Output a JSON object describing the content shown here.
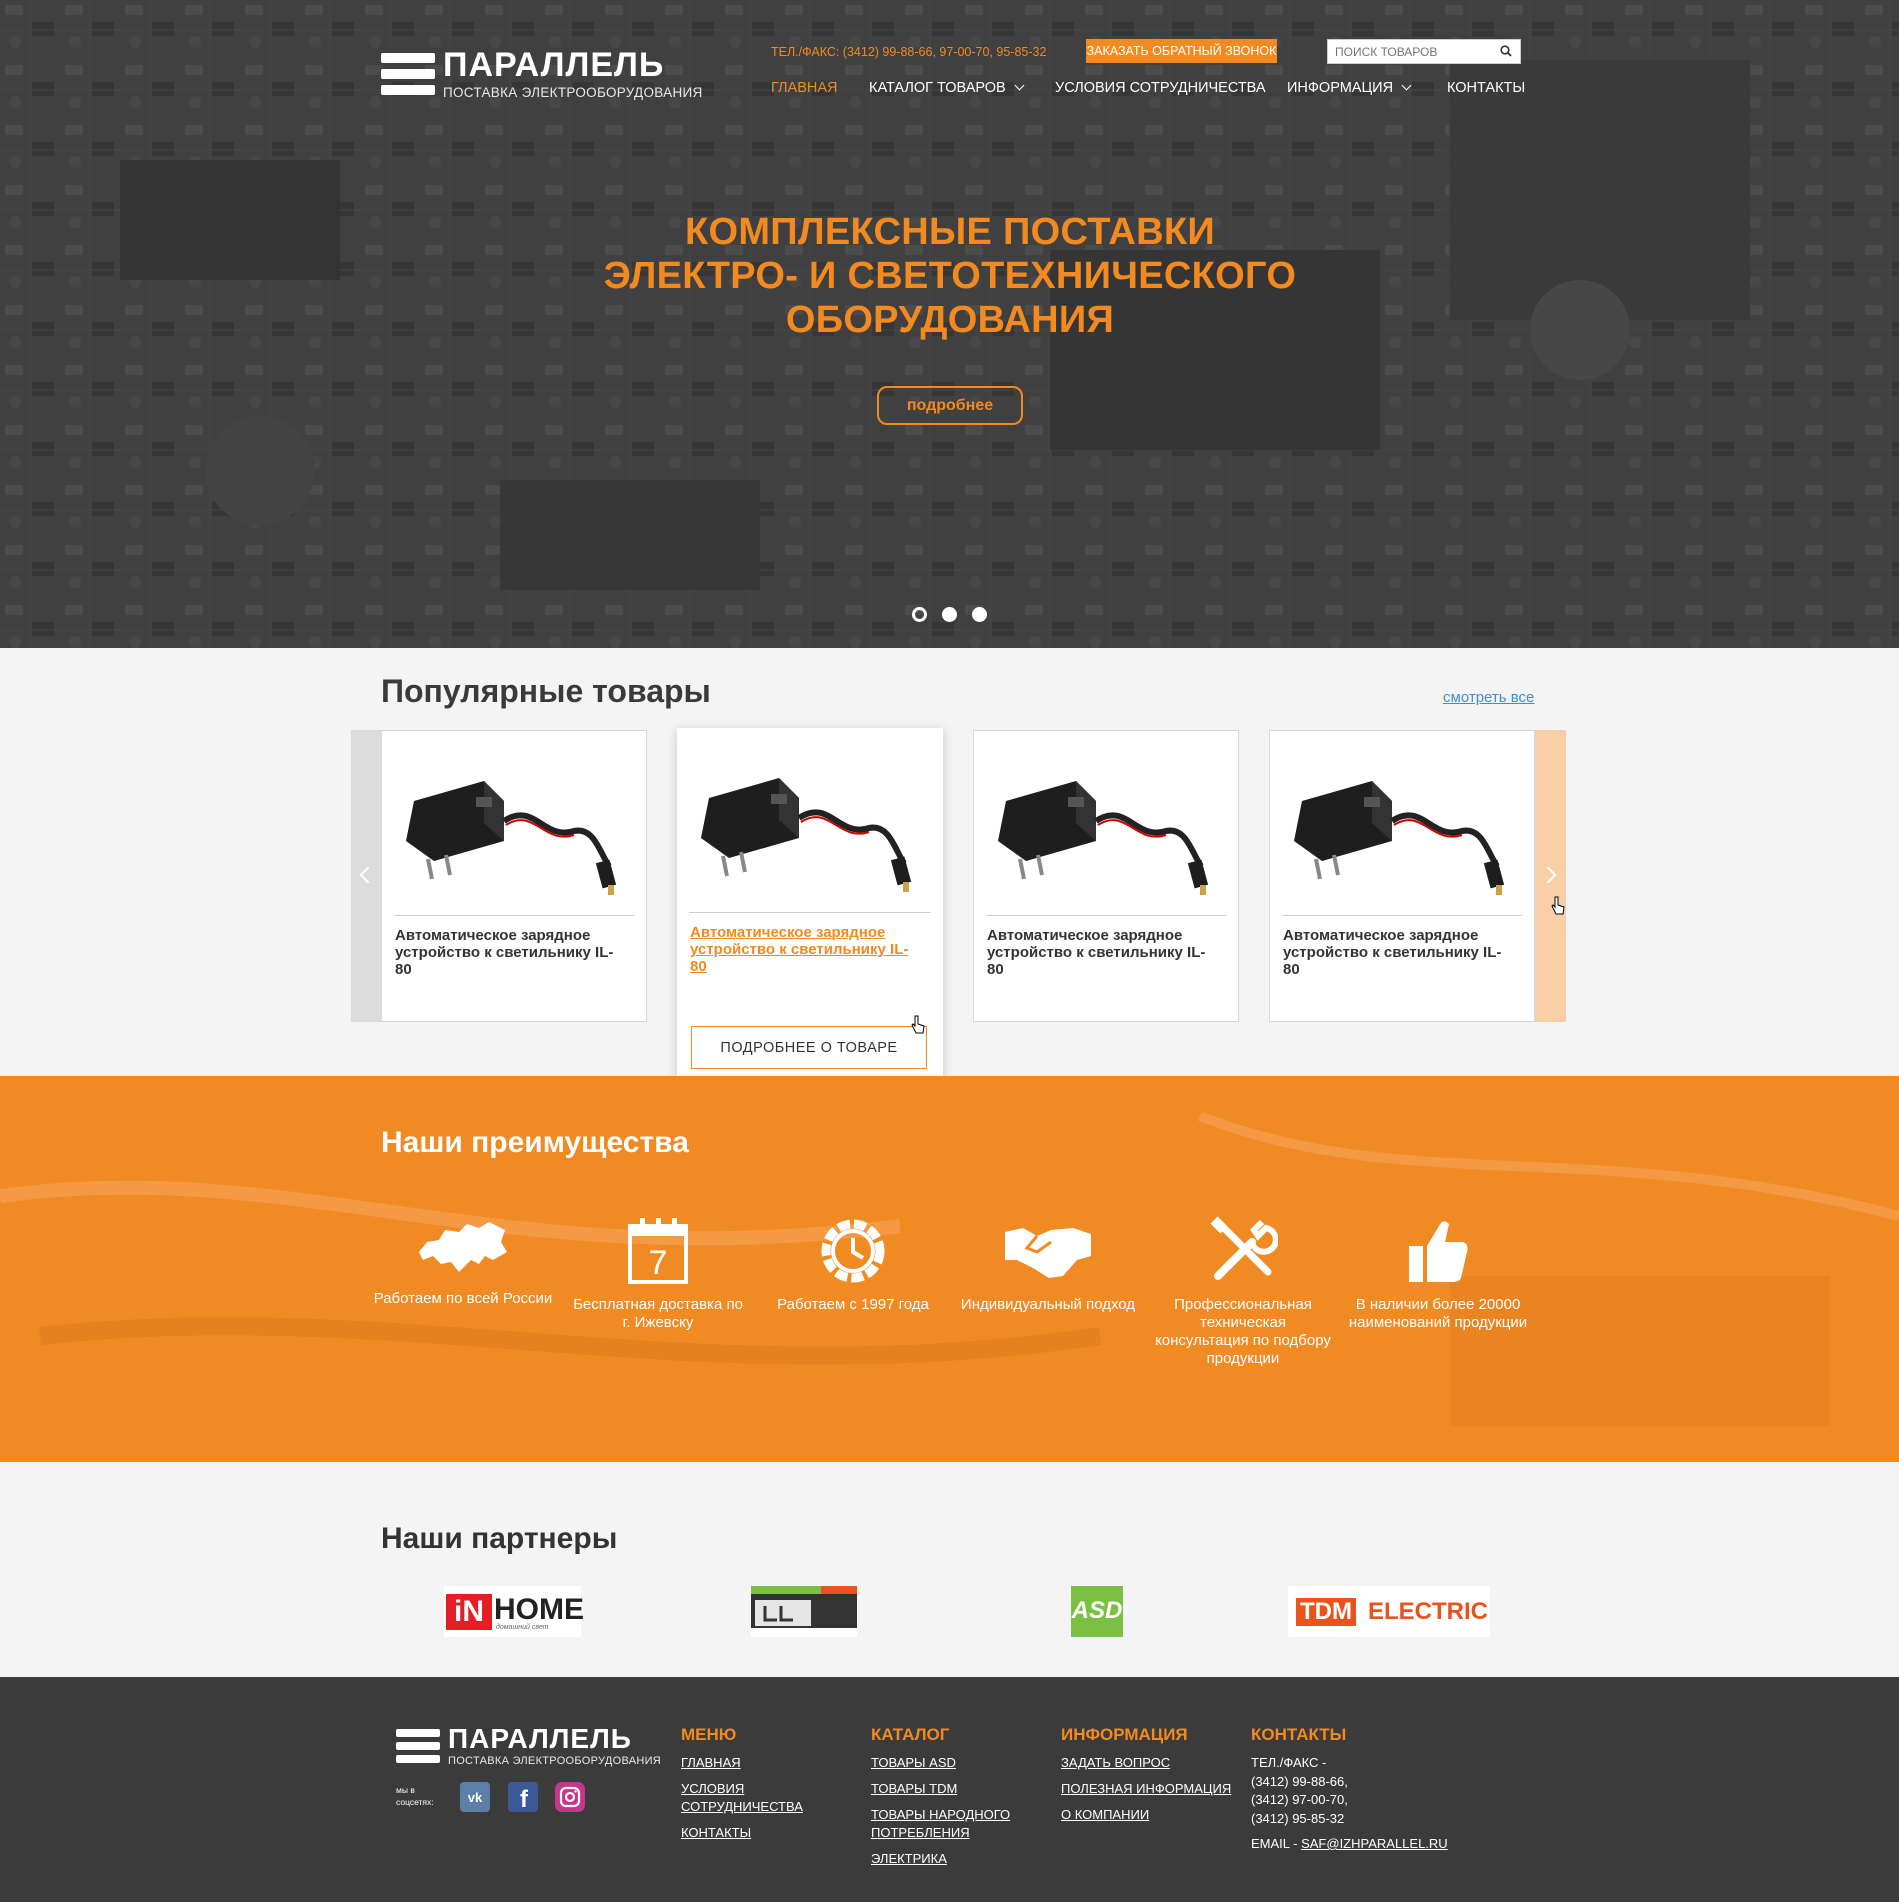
{
  "header": {
    "logo_title": "ПАРАЛЛЕЛЬ",
    "logo_subtitle": "ПОСТАВКА ЭЛЕКТРООБОРУДОВАНИЯ",
    "phone": "ТЕЛ./ФАКС: (3412) 99-88-66, 97-00-70, 95-85-32",
    "callback_button": "ЗАКАЗАТЬ ОБРАТНЫЙ ЗВОНОК",
    "search_placeholder": "ПОИСК ТОВАРОВ",
    "search_icon": "search-icon",
    "nav": [
      {
        "label": "ГЛАВНАЯ",
        "active": true
      },
      {
        "label": "КАТАЛОГ ТОВАРОВ",
        "dropdown": true
      },
      {
        "label": "УСЛОВИЯ СОТРУДНИЧЕСТВА"
      },
      {
        "label": "ИНФОРМАЦИЯ",
        "dropdown": true
      },
      {
        "label": "КОНТАКТЫ"
      }
    ]
  },
  "hero": {
    "title_line1": "КОМПЛЕКСНЫЕ ПОСТАВКИ",
    "title_line2": "ЭЛЕКТРО- И СВЕТОТЕХНИЧЕСКОГО",
    "title_line3": "ОБОРУДОВАНИЯ",
    "button": "подробнее",
    "slides_count": 3,
    "active_slide": 1
  },
  "popular": {
    "title": "Популярные товары",
    "see_all": "смотреть все",
    "products": [
      {
        "name": "Автоматическое зарядное устройство к светильнику IL-80",
        "hovered": false
      },
      {
        "name": "Автоматическое зарядное устройство к светильнику IL-80",
        "hovered": true,
        "button": "ПОДРОБНЕЕ О ТОВАРЕ"
      },
      {
        "name": "Автоматическое зарядное устройство к светильнику IL-80",
        "hovered": false
      },
      {
        "name": "Автоматическое зарядное устройство к светильнику IL-80",
        "hovered": false
      }
    ]
  },
  "advantages": {
    "title": "Наши преимущества",
    "items": [
      {
        "icon": "russia-map-icon",
        "label": "Работаем по всей России"
      },
      {
        "icon": "calendar-icon",
        "label": "Бесплатная доставка по г. Ижевску",
        "calendar_day": "7"
      },
      {
        "icon": "clock-gear-icon",
        "label": "Работаем с 1997 года"
      },
      {
        "icon": "handshake-icon",
        "label": "Индивидуальный подход"
      },
      {
        "icon": "tools-icon",
        "label": "Профессиональная техническая консультация по подбору продукции"
      },
      {
        "icon": "thumbs-up-icon",
        "label": "В наличии более 20000 наименований продукции"
      }
    ]
  },
  "partners": {
    "title": "Наши партнеры",
    "logos": [
      {
        "name": "iN HOME",
        "text_a": "iN",
        "text_b": "HOME",
        "sub": "домашний свет"
      },
      {
        "name": "partner-2-logo"
      },
      {
        "name": "ASD",
        "text": "ASD"
      },
      {
        "name": "TDM ELECTRIC",
        "text_a": "TDM",
        "text_b": "ELECTRIC"
      }
    ]
  },
  "footer": {
    "logo_title": "ПАРАЛЛЕЛЬ",
    "logo_subtitle": "ПОСТАВКА ЭЛЕКТРООБОРУДОВАНИЯ",
    "social_label_1": "мы в",
    "social_label_2": "соцсетях:",
    "social": [
      "vk-icon",
      "facebook-icon",
      "instagram-icon"
    ],
    "menu": {
      "title": "МЕНЮ",
      "links": [
        "ГЛАВНАЯ",
        "УСЛОВИЯ СОТРУДНИЧЕСТВА",
        "КОНТАКТЫ"
      ]
    },
    "catalog": {
      "title": "КАТАЛОГ",
      "links": [
        "ТОВАРЫ ASD",
        "ТОВАРЫ TDM",
        "ТОВАРЫ НАРОДНОГО ПОТРЕБЛЕНИЯ",
        "ЭЛЕКТРИКА"
      ]
    },
    "info": {
      "title": "ИНФОРМАЦИЯ",
      "links": [
        "ЗАДАТЬ ВОПРОС",
        "ПОЛЕЗНАЯ ИНФОРМАЦИЯ",
        "О КОМПАНИИ"
      ]
    },
    "contacts": {
      "title": "КОНТАКТЫ",
      "phone_label": "ТЕЛ./ФАКС -",
      "phones": [
        "(3412) 99-88-66,",
        "(3412) 97-00-70,",
        "(3412) 95-85-32"
      ],
      "email_label": "EMAIL - ",
      "email": "SAF@IZHPARALLEL.RU"
    }
  },
  "colors": {
    "accent": "#f28a1f",
    "footer_bg": "#3b3b3b",
    "advantages_bg": "#f08a23"
  }
}
